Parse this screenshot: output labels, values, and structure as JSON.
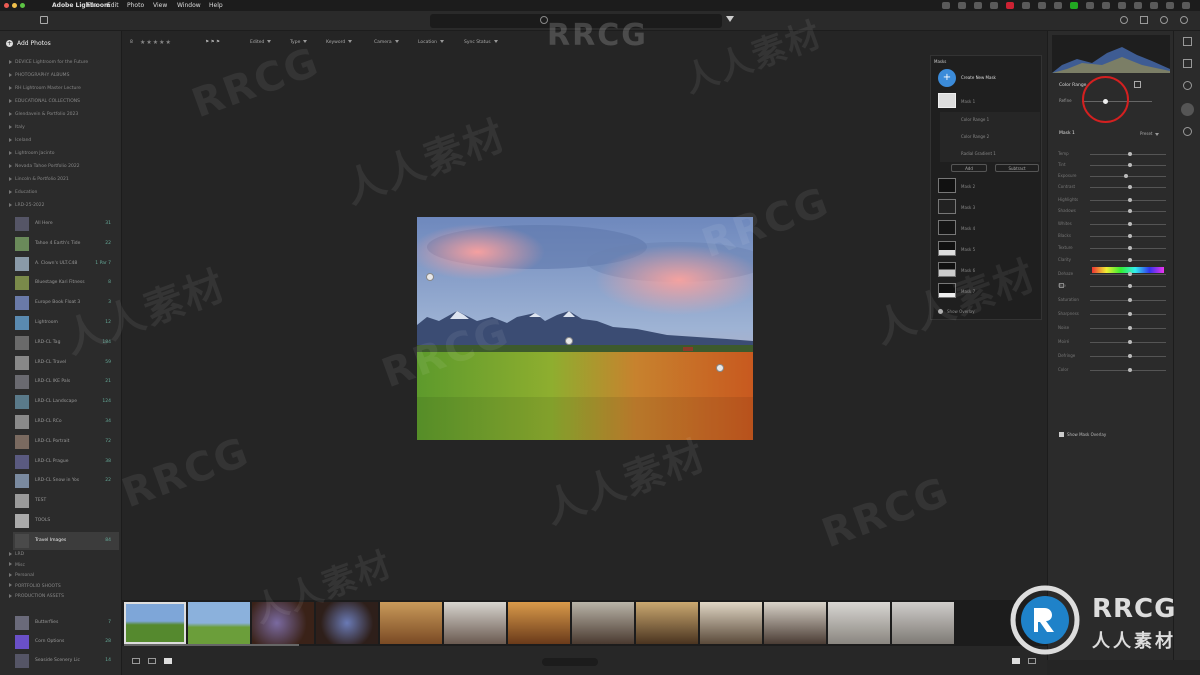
{
  "app": {
    "name": "Adobe Lightroom"
  },
  "menu": [
    "File",
    "Edit",
    "Photo",
    "View",
    "Window",
    "Help"
  ],
  "sidebar": {
    "add_photos": "Add Photos",
    "rows_top": [
      "DEVICE Lightroom for the Future",
      "PHOTOGRAPHY ALBUMS",
      "RH Lightroom Master Lecture",
      "EDUCATIONAL COLLECTIONS",
      "Glendavein & Portfolio 2023",
      "Italy",
      "Iceland",
      "Lightroom Jacinto",
      "Nevada Tahoe Portfolio 2022",
      "Lincoln & Portfolio 2021",
      "Education",
      "LRD-25-2022"
    ],
    "albums": [
      {
        "name": "All Here",
        "count": "31"
      },
      {
        "name": "Tahoe 4 Earth's Tide",
        "count": "22"
      },
      {
        "name": "A. Clown's ULT.C48",
        "count": "1 Par 7"
      },
      {
        "name": "Bluestage Kari Fitness",
        "count": "8"
      },
      {
        "name": "Europe Book Float 3",
        "count": "3"
      },
      {
        "name": "Lightroom",
        "count": "12"
      },
      {
        "name": "LRD-CL Tag",
        "count": "184"
      },
      {
        "name": "LRD-CL Travel",
        "count": "59"
      },
      {
        "name": "LRD-CL IKE Pals",
        "count": "21"
      },
      {
        "name": "LRD-CL Landscape",
        "count": "124"
      },
      {
        "name": "LRD-CL RCo",
        "count": "34"
      },
      {
        "name": "LRD-CL Portrait",
        "count": "72"
      },
      {
        "name": "LRD-CL Prague",
        "count": "38"
      },
      {
        "name": "LRD-CL Snow in Yos",
        "count": "22"
      },
      {
        "name": "TEST",
        "count": ""
      },
      {
        "name": "TOOLS",
        "count": ""
      },
      {
        "name": "Travel Images",
        "count": "84"
      }
    ],
    "rows_bottom": [
      "LRD",
      "Misc",
      "Personal",
      "PORTFOLIO SHOOTS",
      "PRODUCTION ASSETS"
    ],
    "albums_bottom": [
      {
        "name": "Butterflies",
        "count": "7"
      },
      {
        "name": "Corn Options",
        "count": "28"
      },
      {
        "name": "Seaside Scenery Lic",
        "count": "14"
      }
    ]
  },
  "filterbar": {
    "count": "8",
    "stars": "★★★★★",
    "items": [
      "Edited",
      "Type",
      "Keyword",
      "Camera",
      "Location",
      "Sync Status"
    ]
  },
  "masks_panel": {
    "title": "Masks",
    "create": "Create New Mask",
    "items": [
      "Mask 1",
      "Mask 2",
      "Mask 3",
      "Mask 4",
      "Mask 5",
      "Mask 6",
      "Mask 7"
    ],
    "sub_items": [
      "Color Range 1",
      "Color Range 2",
      "Radial Gradient 1"
    ],
    "add": "Add",
    "subtract": "Subtract",
    "show_overlay": "Show Overlay"
  },
  "right_panel": {
    "color_range": "Color Range",
    "refine": "Refine",
    "mask_name": "Mask 1",
    "preset": "Preset",
    "sliders": [
      "Temp",
      "Tint",
      "Exposure",
      "Contrast",
      "Highlights",
      "Shadows",
      "Whites",
      "Blacks",
      "Texture",
      "Clarity",
      "Dehaze",
      "Hue",
      "Saturation",
      "Sharpness",
      "Noise",
      "Moiré",
      "Defringe",
      "Color"
    ],
    "invert": "Invert",
    "show_overlay": "Show Mask Overlay"
  },
  "watermark": {
    "rrcg": "RRCG",
    "cn": "人人素材"
  },
  "colors": {
    "accent": "#3b8bd9",
    "highlight_circle": "#d42020"
  }
}
